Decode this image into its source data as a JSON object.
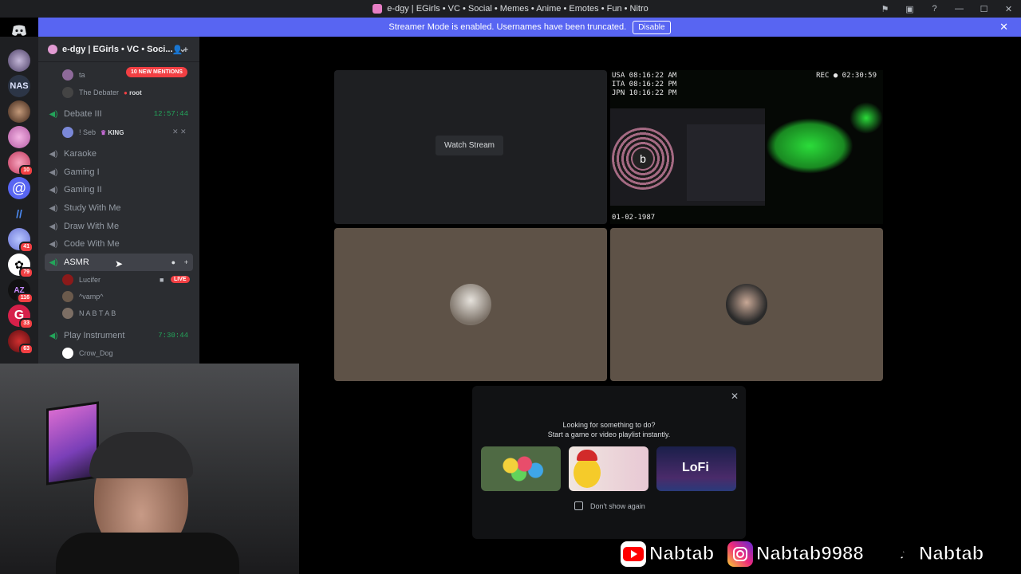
{
  "window": {
    "title": "e-dgy | EGirls • VC • Social • Memes • Anime • Emotes • Fun • Nitro"
  },
  "banner": {
    "text": "Streamer Mode is enabled. Usernames have been truncated.",
    "button_label": "Disable"
  },
  "guild_badges": [
    "41",
    "10",
    "79",
    "116",
    "33",
    "63"
  ],
  "server": {
    "name": "e-dgy | EGirls • VC • Soci..."
  },
  "mentions_pill": "10 NEW MENTIONS",
  "channels": {
    "top_user_1": "ta",
    "top_user_2": "The Debater",
    "top_user_2_tag": "root",
    "debate": {
      "name": "Debate III",
      "timer": "12:57:44",
      "user": "! Seb",
      "user_tag": "KING"
    },
    "karaoke": "Karaoke",
    "gaming1": "Gaming I",
    "gaming2": "Gaming II",
    "study": "Study With Me",
    "draw": "Draw With Me",
    "code": "Code With Me",
    "asmr": {
      "name": "ASMR",
      "users": [
        "Lucifer",
        "^vamp^",
        "N A B T A B"
      ],
      "live_label": "LIVE"
    },
    "instrument": {
      "name": "Play Instrument",
      "timer": "7:30:44",
      "user": "Crow_Dog"
    }
  },
  "stage": {
    "watch_stream_label": "Watch Stream",
    "vcr": {
      "tz_lines": [
        "USA  08:16:22 AM",
        "ITA  08:16:22 PM",
        "JPN  10:16:22 PM"
      ],
      "rec": "REC ● 02:30:59",
      "date": "01-02-1987"
    }
  },
  "activity": {
    "line1": "Looking for something to do?",
    "line2": "Start a game or video playlist instantly.",
    "dont_show": "Don't show again",
    "lofi_brand": "LoFi"
  },
  "socials": {
    "youtube": "Nabtab",
    "instagram": "Nabtab9988",
    "tiktok": "Nabtab"
  }
}
